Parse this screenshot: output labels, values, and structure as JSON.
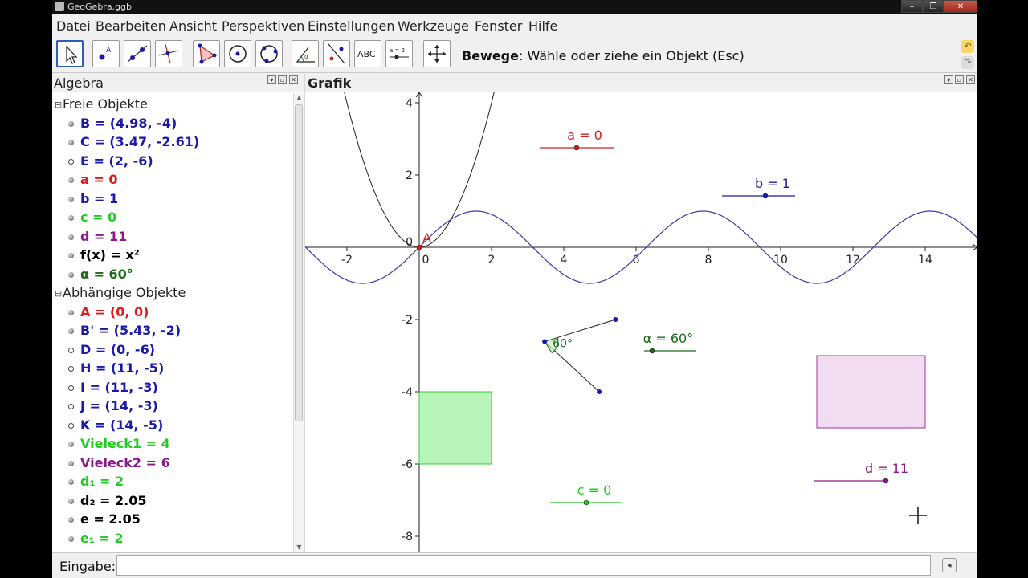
{
  "window": {
    "title": "GeoGebra.ggb"
  },
  "menu": [
    "Datei",
    "Bearbeiten",
    "Ansicht",
    "Perspektiven",
    "Einstellungen",
    "Werkzeuge",
    "Fenster",
    "Hilfe"
  ],
  "toolbar": {
    "help_bold": "Bewege",
    "help_text": ": Wähle oder ziehe ein Objekt (Esc)",
    "text_tool_label": "ABC",
    "slider_tool_label": "a = 2",
    "point_tool_label": "A"
  },
  "algebra": {
    "title": "Algebra",
    "free_group": "Freie Objekte",
    "dependent_group": "Abhängige Objekte",
    "free_items": [
      {
        "text": "B = (4.98, -4)",
        "color": "#1a1aa8",
        "dot": "filled"
      },
      {
        "text": "C = (3.47, -2.61)",
        "color": "#1a1aa8",
        "dot": "filled"
      },
      {
        "text": "E = (2, -6)",
        "color": "#1a1aa8",
        "dot": "hollow"
      },
      {
        "text": "a = 0",
        "color": "#e01b1b",
        "dot": "filled"
      },
      {
        "text": "b = 1",
        "color": "#1a1aa8",
        "dot": "filled"
      },
      {
        "text": "c = 0",
        "color": "#22cc22",
        "dot": "filled"
      },
      {
        "text": "d = 11",
        "color": "#8a1a8a",
        "dot": "filled"
      },
      {
        "text": "f(x) = x²",
        "color": "#000000",
        "dot": "filled"
      },
      {
        "text": "α = 60°",
        "color": "#1a6a1a",
        "dot": "filled"
      }
    ],
    "dependent_items": [
      {
        "text": "A = (0, 0)",
        "color": "#e01b1b",
        "dot": "filled"
      },
      {
        "text": "B' = (5.43, -2)",
        "color": "#1a1aa8",
        "dot": "filled"
      },
      {
        "text": "D = (0, -6)",
        "color": "#1a1aa8",
        "dot": "hollow"
      },
      {
        "text": "H = (11, -5)",
        "color": "#1a1aa8",
        "dot": "hollow"
      },
      {
        "text": "I = (11, -3)",
        "color": "#1a1aa8",
        "dot": "hollow"
      },
      {
        "text": "J = (14, -3)",
        "color": "#1a1aa8",
        "dot": "hollow"
      },
      {
        "text": "K = (14, -5)",
        "color": "#1a1aa8",
        "dot": "hollow"
      },
      {
        "text": "Vieleck1 = 4",
        "color": "#22cc22",
        "dot": "filled"
      },
      {
        "text": "Vieleck2 = 6",
        "color": "#8a1a8a",
        "dot": "filled"
      },
      {
        "text": "d₁ = 2",
        "color": "#22cc22",
        "dot": "filled"
      },
      {
        "text": "d₂ = 2.05",
        "color": "#000000",
        "dot": "filled"
      },
      {
        "text": "e = 2.05",
        "color": "#000000",
        "dot": "filled"
      },
      {
        "text": "e₁ = 2",
        "color": "#22cc22",
        "dot": "filled"
      }
    ]
  },
  "graphics": {
    "title": "Grafik",
    "x_ticks": [
      "-2",
      "0",
      "2",
      "4",
      "6",
      "8",
      "10",
      "12",
      "14"
    ],
    "y_ticks": [
      "4",
      "2",
      "0",
      "-2",
      "-4",
      "-6",
      "-8"
    ],
    "point_label_A": "A",
    "angle_label": "60°",
    "sliders": [
      {
        "label": "a = 0",
        "value": 0,
        "color": "#cc2222"
      },
      {
        "label": "b = 1",
        "value": 1,
        "color": "#1a1aa8"
      },
      {
        "label": "c = 0",
        "value": 0,
        "color": "#22cc22"
      },
      {
        "label": "d = 11",
        "value": 11,
        "color": "#8a1a8a"
      },
      {
        "label": "α = 60°",
        "value": 60,
        "color": "#1a6a1a"
      }
    ]
  },
  "input": {
    "label": "Eingabe:",
    "value": ""
  }
}
